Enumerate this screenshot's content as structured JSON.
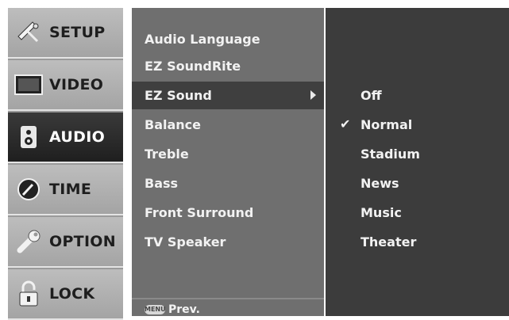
{
  "tabs": [
    {
      "label": "SETUP",
      "icon": "satellite-dish-icon",
      "active": false
    },
    {
      "label": "VIDEO",
      "icon": "tv-screen-icon",
      "active": false
    },
    {
      "label": "AUDIO",
      "icon": "speaker-icon",
      "active": true
    },
    {
      "label": "TIME",
      "icon": "clock-icon",
      "active": false
    },
    {
      "label": "OPTION",
      "icon": "wrench-icon",
      "active": false
    },
    {
      "label": "LOCK",
      "icon": "padlock-icon",
      "active": false
    }
  ],
  "menu": {
    "items": [
      {
        "label": "Audio Language",
        "selected": false
      },
      {
        "label": "EZ SoundRite",
        "selected": false
      },
      {
        "label": "EZ Sound",
        "selected": true
      },
      {
        "label": "Balance",
        "selected": false
      },
      {
        "label": "Treble",
        "selected": false
      },
      {
        "label": "Bass",
        "selected": false
      },
      {
        "label": "Front Surround",
        "selected": false
      },
      {
        "label": "TV Speaker",
        "selected": false
      }
    ],
    "footer": {
      "key_label": "MENU",
      "text": "Prev."
    }
  },
  "submenu": {
    "items": [
      {
        "label": "Off",
        "checked": false
      },
      {
        "label": "Normal",
        "checked": true
      },
      {
        "label": "Stadium",
        "checked": false
      },
      {
        "label": "News",
        "checked": false
      },
      {
        "label": "Music",
        "checked": false
      },
      {
        "label": "Theater",
        "checked": false
      }
    ]
  }
}
